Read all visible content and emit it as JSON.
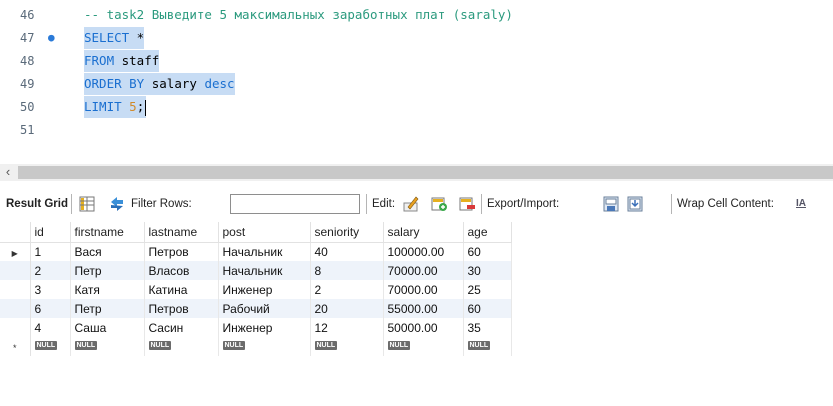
{
  "editor": {
    "lines": [
      {
        "num": "46",
        "text": "-- task2 Выведите 5 максимальных заработных плат (saraly)"
      },
      {
        "num": "47",
        "kw": "SELECT",
        "rest": " *"
      },
      {
        "num": "48",
        "kw": "FROM",
        "rest": " staff"
      },
      {
        "num": "49",
        "kw": "ORDER BY",
        "rest": " salary ",
        "kw2": "desc"
      },
      {
        "num": "50",
        "kw": "LIMIT",
        "rest": " ",
        "num_val": "5",
        "end": ";"
      },
      {
        "num": "51"
      }
    ],
    "marker_icon": "statement-dot-icon",
    "accent_color": "#1a6fd0"
  },
  "scrollbar": {
    "arrow_icon": "chevron-left-icon"
  },
  "toolbar": {
    "result_grid_label": "Result Grid",
    "filter_label": "Filter Rows:",
    "filter_value": "",
    "edit_label": "Edit:",
    "export_label": "Export/Import:",
    "wrap_label": "Wrap Cell Content:",
    "wrap_icon_text": "IA",
    "icons": [
      "grid-view-icon",
      "refresh-arrows-icon",
      "edit-row-icon",
      "add-row-icon",
      "delete-row-icon",
      "export-icon",
      "import-icon",
      "wrap-text-icon"
    ]
  },
  "grid": {
    "columns": [
      "id",
      "firstname",
      "lastname",
      "post",
      "seniority",
      "salary",
      "age"
    ],
    "rows": [
      [
        "1",
        "Вася",
        "Петров",
        "Начальник",
        "40",
        "100000.00",
        "60"
      ],
      [
        "2",
        "Петр",
        "Власов",
        "Начальник",
        "8",
        "70000.00",
        "30"
      ],
      [
        "3",
        "Катя",
        "Катина",
        "Инженер",
        "2",
        "70000.00",
        "25"
      ],
      [
        "6",
        "Петр",
        "Петров",
        "Рабочий",
        "20",
        "55000.00",
        "60"
      ],
      [
        "4",
        "Саша",
        "Сасин",
        "Инженер",
        "12",
        "50000.00",
        "35"
      ]
    ],
    "null_label": "NULL",
    "new_row_marker": "*",
    "current_row_marker": "▶",
    "stripe_color": "#eef3fa"
  }
}
